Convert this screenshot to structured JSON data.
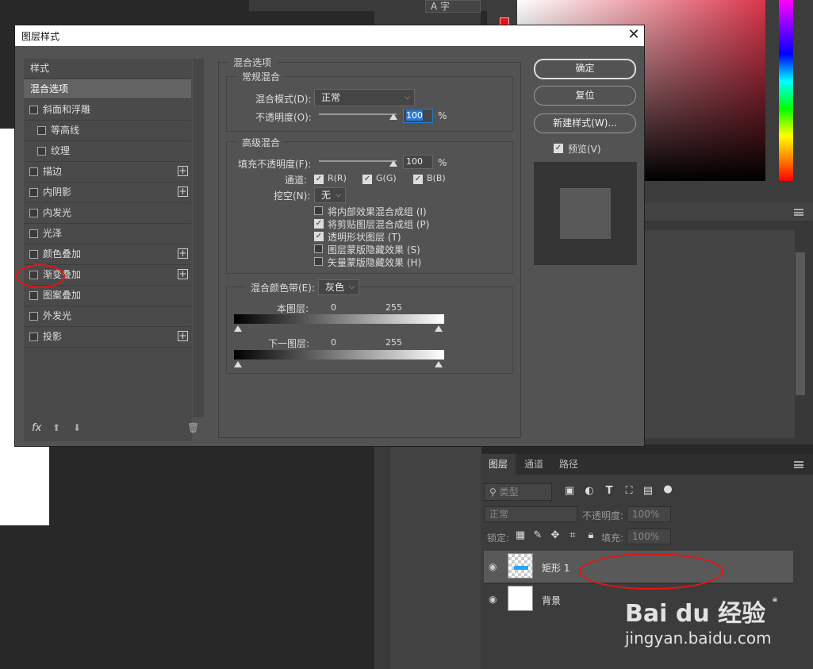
{
  "background_app": {
    "char_button_label": "A 字",
    "layers_tabs": [
      "图层",
      "通道",
      "路径"
    ],
    "filter_placeholder": "类型",
    "blend_mode": "正常",
    "opacity_label": "不透明度:",
    "opacity_value": "100%",
    "lock_label": "锁定:",
    "fill_label": "填充:",
    "fill_value": "100%",
    "layers": [
      {
        "name": "矩形 1"
      },
      {
        "name": "背景"
      }
    ]
  },
  "dialog": {
    "title": "图层样式",
    "left_list": {
      "header": "样式",
      "items": [
        {
          "label": "混合选项",
          "checkbox": false,
          "plus": false
        },
        {
          "label": "斜面和浮雕",
          "checkbox": true,
          "plus": false
        },
        {
          "label": "等高线",
          "checkbox": true,
          "plus": false,
          "indent": true
        },
        {
          "label": "纹理",
          "checkbox": true,
          "plus": false,
          "indent": true
        },
        {
          "label": "描边",
          "checkbox": true,
          "plus": true
        },
        {
          "label": "内阴影",
          "checkbox": true,
          "plus": true
        },
        {
          "label": "内发光",
          "checkbox": true,
          "plus": false
        },
        {
          "label": "光泽",
          "checkbox": true,
          "plus": false
        },
        {
          "label": "颜色叠加",
          "checkbox": true,
          "plus": true
        },
        {
          "label": "渐变叠加",
          "checkbox": true,
          "plus": true
        },
        {
          "label": "图案叠加",
          "checkbox": true,
          "plus": false
        },
        {
          "label": "外发光",
          "checkbox": true,
          "plus": false
        },
        {
          "label": "投影",
          "checkbox": true,
          "plus": true
        }
      ],
      "fx_label": "fx"
    },
    "blend_options": {
      "title": "混合选项",
      "general": {
        "title": "常规混合",
        "mode_label": "混合模式(D):",
        "mode_value": "正常",
        "opacity_label": "不透明度(O):",
        "opacity_value": "100",
        "percent": "%"
      },
      "advanced": {
        "title": "高级混合",
        "fill_label": "填充不透明度(F):",
        "fill_value": "100",
        "percent": "%",
        "channels_label": "通道:",
        "channel_r": "R(R)",
        "channel_g": "G(G)",
        "channel_b": "B(B)",
        "knockout_label": "挖空(N):",
        "knockout_value": "无",
        "options": [
          {
            "label": "将内部效果混合成组 (I)",
            "checked": false
          },
          {
            "label": "将剪贴图层混合成组 (P)",
            "checked": true
          },
          {
            "label": "透明形状图层 (T)",
            "checked": true
          },
          {
            "label": "图层蒙版隐藏效果 (S)",
            "checked": false
          },
          {
            "label": "矢量蒙版隐藏效果 (H)",
            "checked": false
          }
        ]
      },
      "blend_if": {
        "label": "混合颜色带(E):",
        "value": "灰色",
        "this_layer": "本图层:",
        "underlying": "下一图层:",
        "min": "0",
        "max": "255"
      }
    },
    "buttons": {
      "ok": "确定",
      "reset": "复位",
      "new_style": "新建样式(W)...",
      "preview_label": "预览(V)"
    }
  },
  "watermark": {
    "line1": "Bai du 经验",
    "line2": "jingyan.baidu.com"
  }
}
